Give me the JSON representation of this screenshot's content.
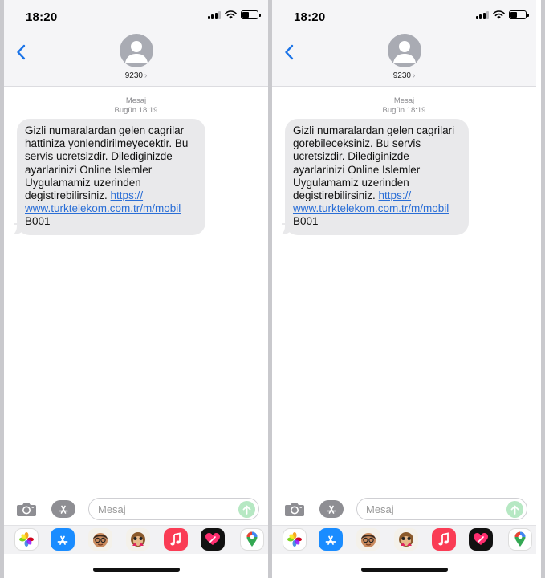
{
  "screens": [
    {
      "status_time": "18:20",
      "contact": {
        "name": "9230",
        "chevron": "›"
      },
      "back_icon": "chevron-left-icon",
      "conversation": {
        "service_label": "Mesaj",
        "timestamp": "Bugün 18:19"
      },
      "message": {
        "lines": [
          "Gizli numaralardan gelen cagrilar",
          "hattiniza yonlendirilmeyecektir. Bu",
          "servis ucretsizdir. Dilediginizde",
          "ayarlarinizi Online Islemler",
          "Uygulamamiz uzerinden",
          "degistirebilirsiniz. "
        ],
        "link_part1": "https://",
        "link_part2": "www.turktelekom.com.tr/m/mobil",
        "code": "B001"
      },
      "input_placeholder": "Mesaj"
    },
    {
      "status_time": "18:20",
      "contact": {
        "name": "9230",
        "chevron": "›"
      },
      "back_icon": "chevron-left-icon",
      "conversation": {
        "service_label": "Mesaj",
        "timestamp": "Bugün 18:19"
      },
      "message": {
        "lines": [
          "Gizli numaralardan gelen cagrilari",
          "gorebileceksiniz. Bu servis",
          "ucretsizdir. Dilediginizde",
          "ayarlarinizi Online Islemler",
          "Uygulamamiz uzerinden",
          "degistirebilirsiniz. "
        ],
        "link_part1": "https://",
        "link_part2": "www.turktelekom.com.tr/m/mobil",
        "code": "B001"
      },
      "input_placeholder": "Mesaj"
    }
  ],
  "app_drawer": [
    {
      "name": "photos-app-icon"
    },
    {
      "name": "app-store-icon"
    },
    {
      "name": "memoji-icon"
    },
    {
      "name": "animoji-icon"
    },
    {
      "name": "music-app-icon"
    },
    {
      "name": "digital-touch-icon"
    },
    {
      "name": "maps-app-icon"
    }
  ],
  "colors": {
    "link": "#2a6ed6",
    "bubble": "#e9e9eb",
    "header_bg": "#f5f5f7",
    "accent_blue": "#1a73e8",
    "send_disabled": "#b6e8c3"
  }
}
